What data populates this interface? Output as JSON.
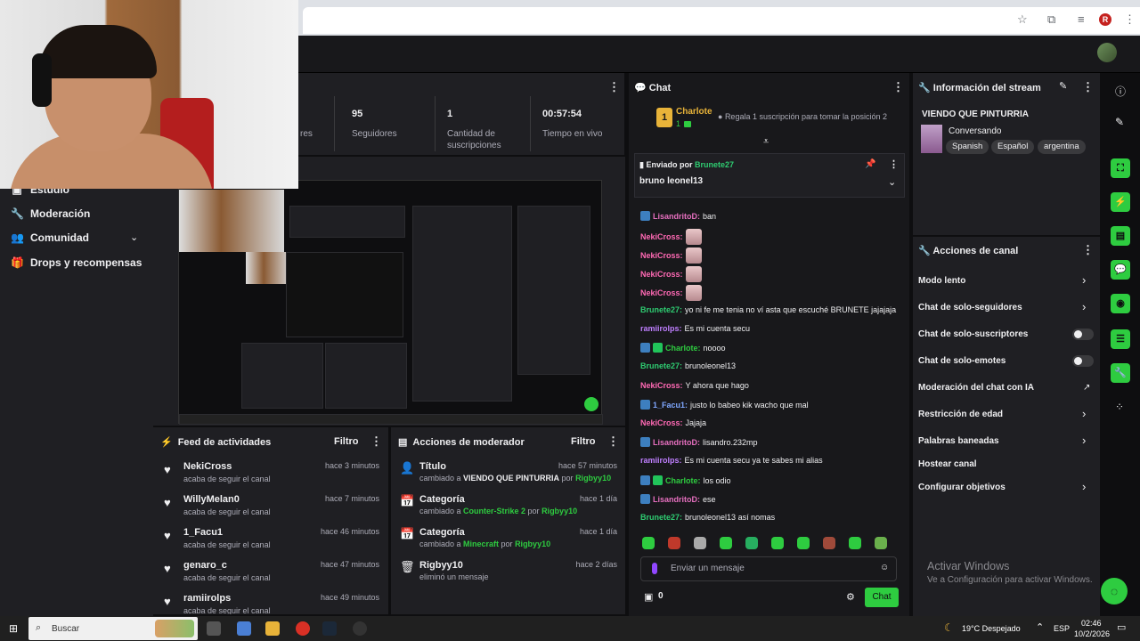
{
  "colors": {
    "accent": "#2ecc40",
    "bg": "#0e0e10",
    "panel": "#1f1f23",
    "chat_bg": "#18181b"
  },
  "stats": {
    "partial_label": "res",
    "followers_value": "95",
    "followers_label": "Seguidores",
    "subs_value": "1",
    "subs_label": "Cantidad de suscripciones",
    "live_value": "00:57:54",
    "live_label": "Tiempo en vivo"
  },
  "nav": {
    "items": [
      {
        "label": "Estudio",
        "icon": "studio-icon"
      },
      {
        "label": "Moderación",
        "icon": "wrench-icon"
      },
      {
        "label": "Comunidad",
        "icon": "people-icon"
      },
      {
        "label": "Drops y recompensas",
        "icon": "gift-icon"
      }
    ]
  },
  "feed": {
    "title": "Feed de actividades",
    "filter": "Filtro",
    "items": [
      {
        "name": "NekiCross",
        "sub": "acaba de seguir el canal",
        "time": "hace 3 minutos"
      },
      {
        "name": "WillyMelan0",
        "sub": "acaba de seguir el canal",
        "time": "hace 7 minutos"
      },
      {
        "name": "1_Facu1",
        "sub": "acaba de seguir el canal",
        "time": "hace 46 minutos"
      },
      {
        "name": "genaro_c",
        "sub": "acaba de seguir el canal",
        "time": "hace 47 minutos"
      },
      {
        "name": "ramiirolps",
        "sub": "acaba de seguir el canal",
        "time": "hace 49 minutos"
      }
    ]
  },
  "mod": {
    "title": "Acciones de moderador",
    "filter": "Filtro",
    "items": [
      {
        "title": "Título",
        "pre": "cambiado a ",
        "value": "VIENDO QUE PINTURRIA",
        "mid": " por ",
        "by": "Rigbyy10",
        "time": "hace 57 minutos"
      },
      {
        "title": "Categoría",
        "pre": "cambiado a ",
        "value": "Counter-Strike 2",
        "mid": " por ",
        "by": "Rigbyy10",
        "time": "hace 1 día"
      },
      {
        "title": "Categoría",
        "pre": "cambiado a ",
        "value": "Minecraft",
        "mid": " por ",
        "by": "Rigbyy10",
        "time": "hace 1 día"
      },
      {
        "title": "Rigbyy10",
        "pre": "eliminó un mensaje",
        "value": "",
        "mid": "",
        "by": "",
        "time": "hace 2 días"
      }
    ]
  },
  "chat": {
    "title": "Chat",
    "leader_rank": "1",
    "leader_name": "Charlote",
    "leader_count": "1",
    "leader_hint": "Regala 1 suscripción para tomar la posición 2",
    "pinned_by_label": "Enviado por",
    "pinned_by": "Brunete27",
    "pinned_text": "bruno leonel13",
    "messages": [
      {
        "user": "LisandritoD",
        "color": "#e56fbe",
        "badge": "b",
        "text": "ban"
      },
      {
        "user": "NekiCross",
        "color": "#ff69b4",
        "badge": "",
        "text": "",
        "emote": true
      },
      {
        "user": "NekiCross",
        "color": "#ff69b4",
        "badge": "",
        "text": "",
        "emote": true
      },
      {
        "user": "NekiCross",
        "color": "#ff69b4",
        "badge": "",
        "text": "",
        "emote": true
      },
      {
        "user": "NekiCross",
        "color": "#ff69b4",
        "badge": "",
        "text": "",
        "emote": true
      },
      {
        "user": "Brunete27",
        "color": "#2ecc71",
        "badge": "",
        "text": "yo ni fe me tenia no ví asta que escuché BRUNETE jajajaja"
      },
      {
        "user": "ramiirolps",
        "color": "#bf7fff",
        "badge": "",
        "text": "Es mi cuenta secu"
      },
      {
        "user": "Charlote",
        "color": "#2ecc40",
        "badge": "bg",
        "text": "noooo"
      },
      {
        "user": "Brunete27",
        "color": "#2ecc71",
        "badge": "",
        "text": "brunoleonel13"
      },
      {
        "user": "NekiCross",
        "color": "#ff69b4",
        "badge": "",
        "text": "Y ahora que hago"
      },
      {
        "user": "1_Facu1",
        "color": "#7fa8ff",
        "badge": "b",
        "text": "justo lo babeo kik wacho que mal"
      },
      {
        "user": "NekiCross",
        "color": "#ff69b4",
        "badge": "",
        "text": "Jajaja"
      },
      {
        "user": "LisandritoD",
        "color": "#e56fbe",
        "badge": "b",
        "text": "lisandro.232mp"
      },
      {
        "user": "ramiirolps",
        "color": "#bf7fff",
        "badge": "",
        "text": "Es mi cuenta secu ya te sabes mi alias"
      },
      {
        "user": "Charlote",
        "color": "#2ecc40",
        "badge": "bg",
        "text": "los odio"
      },
      {
        "user": "LisandritoD",
        "color": "#e56fbe",
        "badge": "b",
        "text": "ese"
      },
      {
        "user": "Brunete27",
        "color": "#2ecc71",
        "badge": "",
        "text": "brunoleonel13 así nomas"
      }
    ],
    "input_placeholder": "Enviar un mensaje",
    "points": "0",
    "send_label": "Chat"
  },
  "stream_info": {
    "title": "Información del stream",
    "stream_title": "VIENDO QUE PINTURRIA",
    "category": "Conversando",
    "tags": [
      "Spanish",
      "Español",
      "argentina"
    ]
  },
  "actions": {
    "title": "Acciones de canal",
    "items": [
      {
        "label": "Modo lento",
        "kind": "arrow"
      },
      {
        "label": "Chat de solo-seguidores",
        "kind": "arrow"
      },
      {
        "label": "Chat de solo-suscriptores",
        "kind": "toggle"
      },
      {
        "label": "Chat de solo-emotes",
        "kind": "toggle"
      },
      {
        "label": "Moderación del chat con IA",
        "kind": "external"
      },
      {
        "label": "Restricción de edad",
        "kind": "arrow"
      },
      {
        "label": "Palabras baneadas",
        "kind": "arrow"
      },
      {
        "label": "Hostear canal",
        "kind": "none"
      },
      {
        "label": "Configurar objetivos",
        "kind": "arrow"
      }
    ]
  },
  "watermark": {
    "title": "Activar Windows",
    "sub": "Ve a Configuración para activar Windows."
  },
  "taskbar": {
    "search": "Buscar",
    "weather": "19°C Despejado",
    "lang": "ESP",
    "time": "02:46",
    "date": "10/2/2026"
  }
}
